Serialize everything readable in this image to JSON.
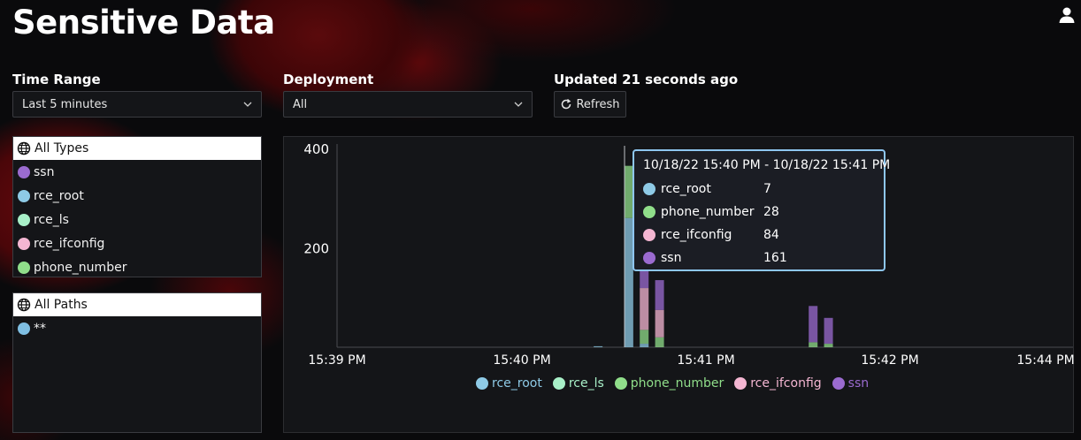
{
  "header": {
    "title": "Sensitive Data",
    "user_icon": "user-icon"
  },
  "filters": {
    "time_range": {
      "label": "Time Range",
      "value": "Last 5 minutes"
    },
    "deployment": {
      "label": "Deployment",
      "value": "All"
    },
    "updated_text": "Updated 21 seconds ago",
    "refresh_label": "Refresh"
  },
  "types_panel": {
    "header": "All Types",
    "items": [
      {
        "label": "ssn",
        "color": "#9b6bd0"
      },
      {
        "label": "rce_root",
        "color": "#8ecae6"
      },
      {
        "label": "rce_ls",
        "color": "#a8f0c8"
      },
      {
        "label": "rce_ifconfig",
        "color": "#f4b6d2"
      },
      {
        "label": "phone_number",
        "color": "#90de8a"
      }
    ]
  },
  "paths_panel": {
    "header": "All Paths",
    "items": [
      {
        "label": "**",
        "color": "#7fbfe3"
      }
    ]
  },
  "tooltip": {
    "title": "10/18/22 15:40 PM - 10/18/22 15:41 PM",
    "rows": [
      {
        "name": "rce_root",
        "value": "7",
        "color": "#8ecae6"
      },
      {
        "name": "phone_number",
        "value": "28",
        "color": "#90de8a"
      },
      {
        "name": "rce_ifconfig",
        "value": "84",
        "color": "#f4b6d2"
      },
      {
        "name": "ssn",
        "value": "161",
        "color": "#9b6bd0"
      }
    ]
  },
  "chart_data": {
    "type": "bar",
    "stacked": true,
    "x_ticks": [
      "15:39 PM",
      "15:40 PM",
      "15:41 PM",
      "15:42 PM",
      "15:44 PM"
    ],
    "y_ticks": [
      200,
      400
    ],
    "ylim": [
      0,
      400
    ],
    "series": [
      {
        "name": "rce_root",
        "color": "#8ecae6"
      },
      {
        "name": "rce_ls",
        "color": "#a8f0c8"
      },
      {
        "name": "phone_number",
        "color": "#90de8a"
      },
      {
        "name": "rce_ifconfig",
        "color": "#f4b6d2"
      },
      {
        "name": "ssn",
        "color": "#9b6bd0"
      }
    ],
    "bars": [
      {
        "time": "15:40:25",
        "rce_root": 2,
        "rce_ls": 0,
        "phone_number": 0,
        "rce_ifconfig": 0,
        "ssn": 0
      },
      {
        "time": "15:40:35",
        "rce_root": 260,
        "rce_ls": 0,
        "phone_number": 105,
        "rce_ifconfig": 0,
        "ssn": 0
      },
      {
        "time": "15:40:40",
        "rce_root": 7,
        "rce_ls": 0,
        "phone_number": 28,
        "rce_ifconfig": 84,
        "ssn": 161
      },
      {
        "time": "15:40:45",
        "rce_root": 0,
        "rce_ls": 0,
        "phone_number": 20,
        "rce_ifconfig": 55,
        "ssn": 60
      },
      {
        "time": "15:41:35",
        "rce_root": 0,
        "rce_ls": 0,
        "phone_number": 10,
        "rce_ifconfig": 0,
        "ssn": 73
      },
      {
        "time": "15:41:40",
        "rce_root": 0,
        "rce_ls": 0,
        "phone_number": 7,
        "rce_ifconfig": 0,
        "ssn": 52
      }
    ],
    "legend": [
      "rce_root",
      "rce_ls",
      "phone_number",
      "rce_ifconfig",
      "ssn"
    ],
    "legend_position": "bottom-center"
  }
}
